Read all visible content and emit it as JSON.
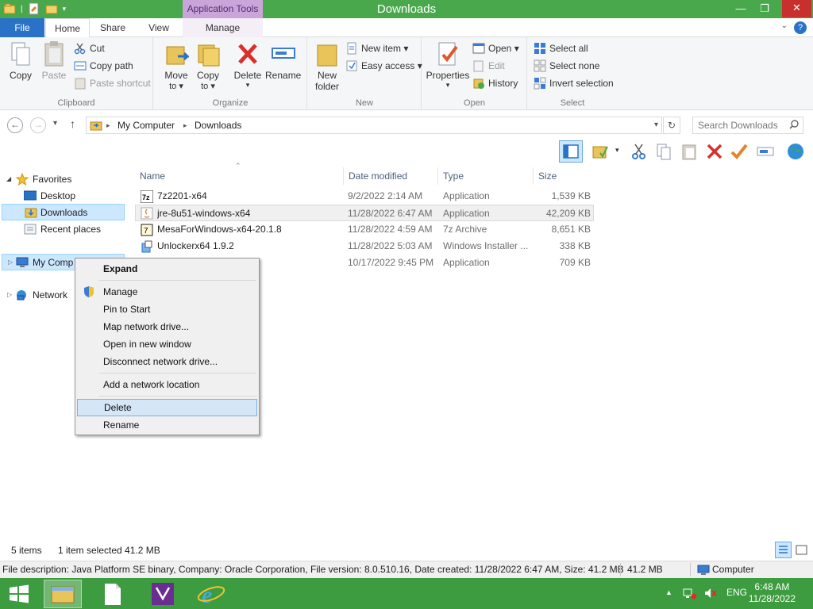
{
  "window": {
    "title": "Downloads",
    "context_tab_label": "Application Tools",
    "controls": {
      "minimize": "—",
      "maximize": "❐",
      "close": "✕"
    }
  },
  "ribbon_tabs": {
    "file": "File",
    "home": "Home",
    "share": "Share",
    "view": "View",
    "manage": "Manage",
    "help": "?"
  },
  "ribbon": {
    "clipboard": {
      "label": "Clipboard",
      "copy": "Copy",
      "paste": "Paste",
      "cut": "Cut",
      "copy_path": "Copy path",
      "paste_shortcut": "Paste shortcut"
    },
    "organize": {
      "label": "Organize",
      "move_to": "Move\nto ▾",
      "move_to_1": "Move",
      "move_to_2": "to ▾",
      "copy_to_1": "Copy",
      "copy_to_2": "to ▾",
      "delete": "Delete",
      "delete_arrow": "▾",
      "rename": "Rename"
    },
    "new": {
      "label": "New",
      "new_folder_1": "New",
      "new_folder_2": "folder",
      "new_item": "New item ▾",
      "easy_access": "Easy access ▾"
    },
    "open": {
      "label": "Open",
      "properties": "Properties",
      "properties_arrow": "▾",
      "open": "Open ▾",
      "edit": "Edit",
      "history": "History"
    },
    "select": {
      "label": "Select",
      "select_all": "Select all",
      "select_none": "Select none",
      "invert": "Invert selection"
    }
  },
  "address": {
    "back": "←",
    "forward": "→",
    "recent": "▾",
    "up": "↑",
    "crumbs": [
      "My Computer",
      "Downloads"
    ],
    "sep": "▸",
    "dropdown": "▾",
    "refresh": "↻",
    "search_placeholder": "Search Downloads"
  },
  "nav": {
    "favorites": "Favorites",
    "desktop": "Desktop",
    "downloads": "Downloads",
    "recent": "Recent places",
    "computer": "My Comp",
    "network": "Network"
  },
  "columns": {
    "name": "Name",
    "date": "Date modified",
    "type": "Type",
    "size": "Size"
  },
  "files": [
    {
      "name": "7z2201-x64",
      "date": "9/2/2022 2:14 AM",
      "type": "Application",
      "size": "1,539 KB"
    },
    {
      "name": "jre-8u51-windows-x64",
      "date": "11/28/2022 6:47 AM",
      "type": "Application",
      "size": "42,209 KB"
    },
    {
      "name": "MesaForWindows-x64-20.1.8",
      "date": "11/28/2022 4:59 AM",
      "type": "7z Archive",
      "size": "8,651 KB"
    },
    {
      "name": "Unlockerx64 1.9.2",
      "date": "11/28/2022 5:03 AM",
      "type": "Windows Installer ...",
      "size": "338 KB"
    },
    {
      "name": "",
      "date": "10/17/2022 9:45 PM",
      "type": "Application",
      "size": "709 KB"
    }
  ],
  "context_menu": {
    "expand": "Expand",
    "manage": "Manage",
    "pin": "Pin to Start",
    "map": "Map network drive...",
    "open_new": "Open in new window",
    "disconnect": "Disconnect network drive...",
    "add_location": "Add a network location",
    "delete": "Delete",
    "rename": "Rename"
  },
  "status": {
    "items": "5 items",
    "selected": "1 item selected  41.2 MB"
  },
  "details_bar": {
    "description": "File description: Java Platform SE binary, Company: Oracle Corporation, File version: 8.0.510.16, Date created: 11/28/2022 6:47 AM, Size: 41.2 MB",
    "size": "41.2 MB",
    "location": "Computer"
  },
  "taskbar": {
    "lang": "ENG",
    "time": "6:48 AM",
    "date": "11/28/2022",
    "tray_arrow": "▲"
  },
  "colors": {
    "titlebar": "#4aa84c",
    "taskbar": "#3d9c3f",
    "accent": "#2a72c8",
    "context_tab": "#c9a5d9",
    "selection": "#cce8ff"
  }
}
